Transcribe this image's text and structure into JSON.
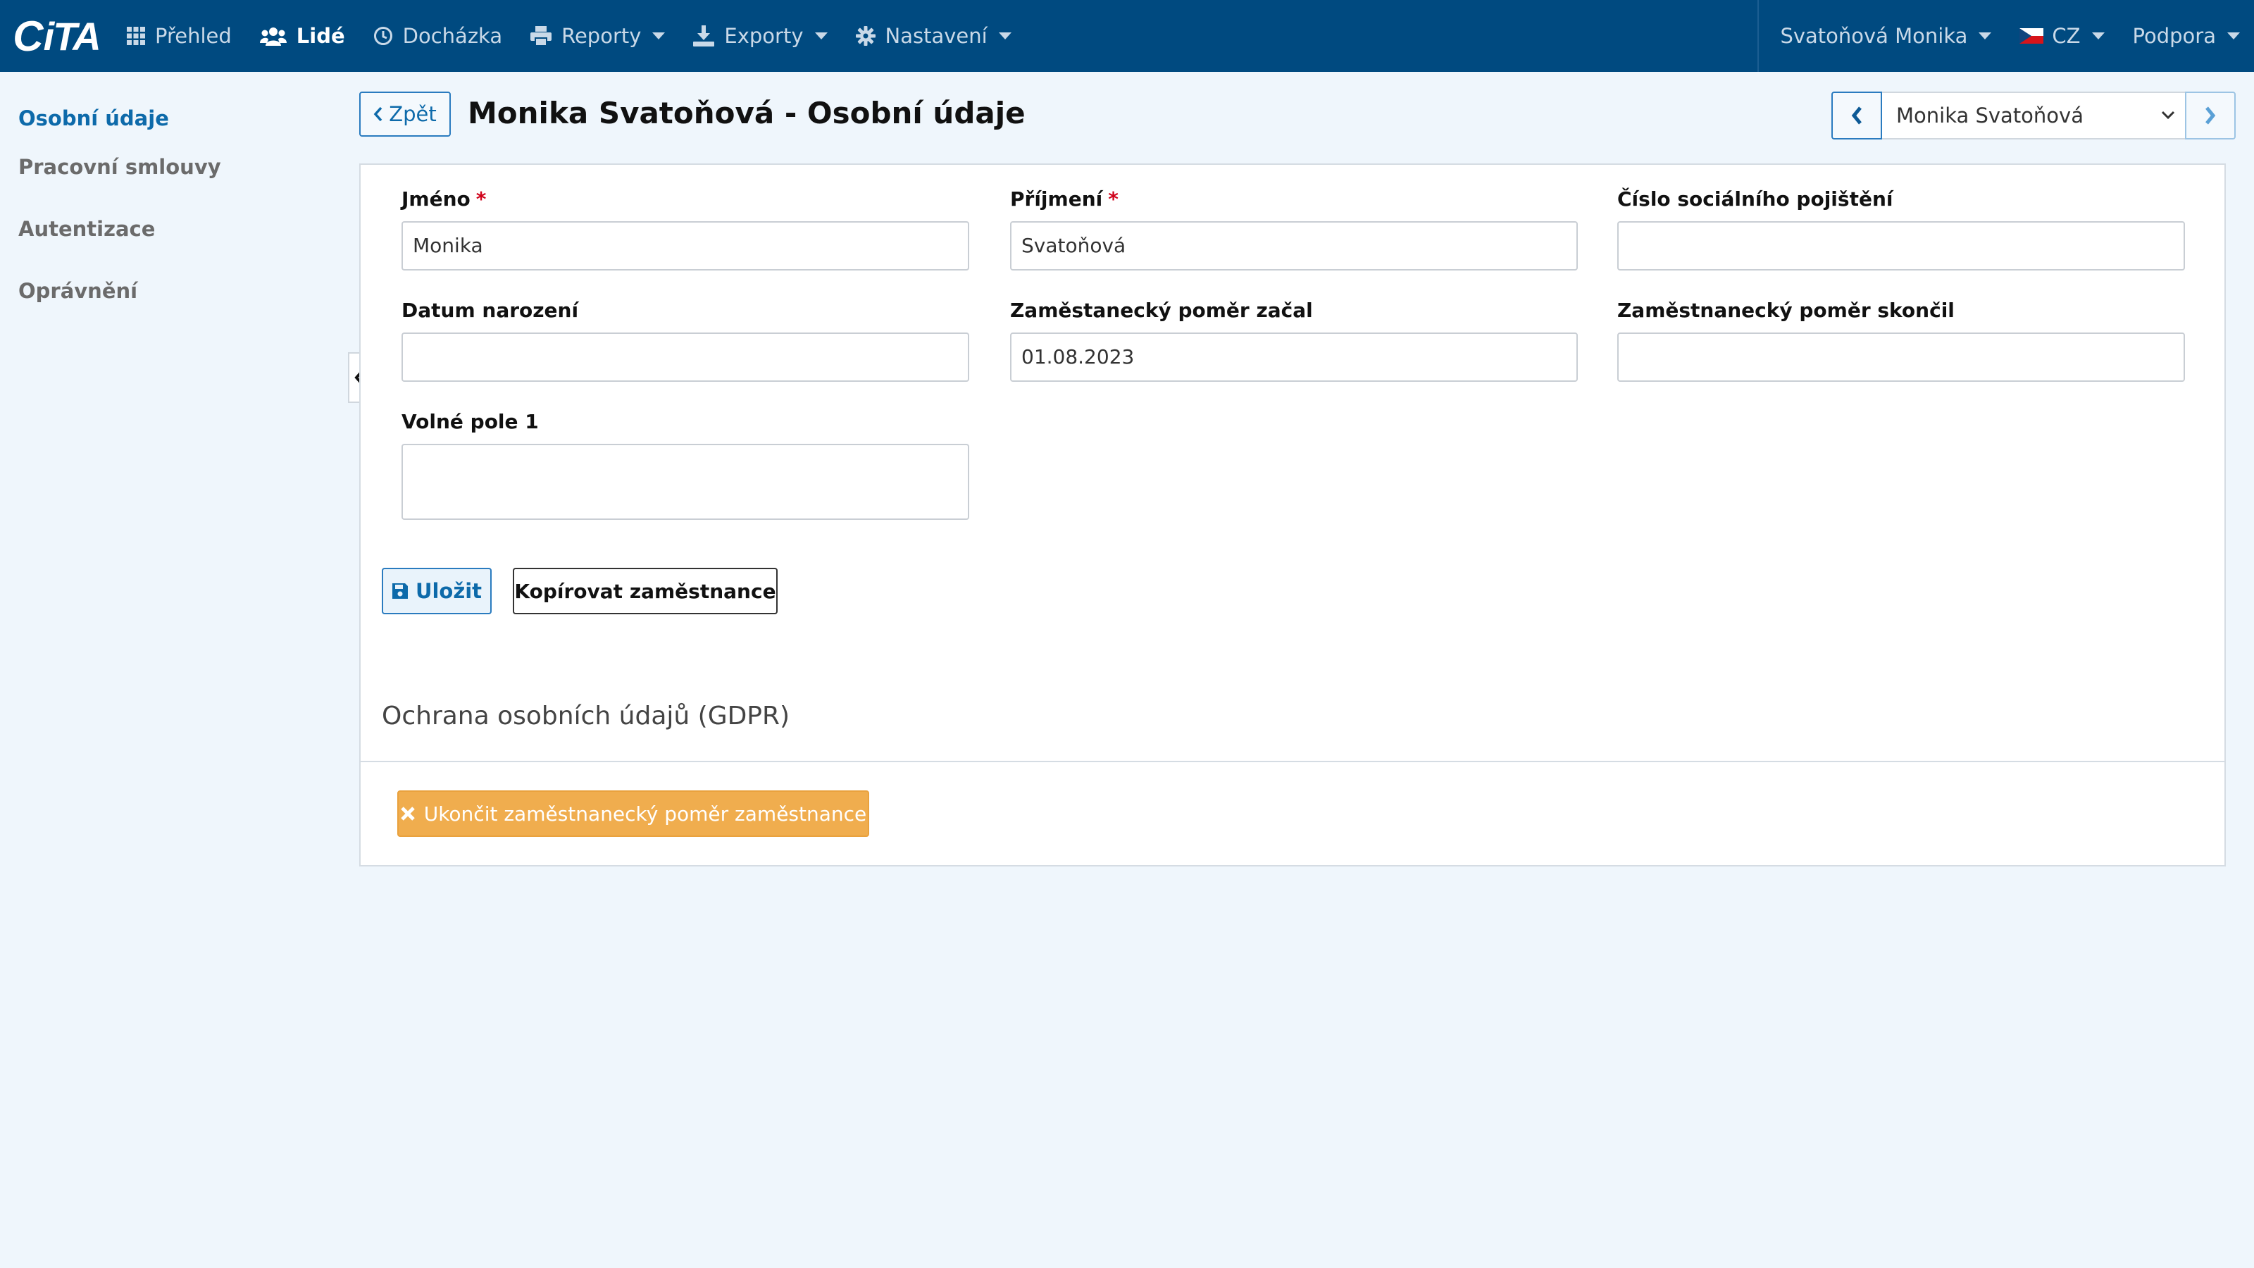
{
  "app": {
    "logo_text": "iTA"
  },
  "navbar": {
    "items": [
      {
        "label": "Přehled",
        "icon": "grid-icon",
        "active": false,
        "dropdown": false
      },
      {
        "label": "Lidé",
        "icon": "users-icon",
        "active": true,
        "dropdown": false
      },
      {
        "label": "Docházka",
        "icon": "clock-icon",
        "active": false,
        "dropdown": false
      },
      {
        "label": "Reporty",
        "icon": "printer-icon",
        "active": false,
        "dropdown": true
      },
      {
        "label": "Exporty",
        "icon": "download-icon",
        "active": false,
        "dropdown": true
      },
      {
        "label": "Nastavení",
        "icon": "gear-icon",
        "active": false,
        "dropdown": true
      }
    ],
    "user": "Svatoňová Monika",
    "language": "CZ",
    "support": "Podpora",
    "colors": {
      "background": "#004a80",
      "text": "#c9d9e8",
      "active_text": "#ffffff"
    }
  },
  "sidebar": {
    "items": [
      {
        "label": "Osobní údaje",
        "active": true
      },
      {
        "label": "Pracovní smlouvy",
        "active": false
      },
      {
        "label": "Autentizace",
        "active": false
      },
      {
        "label": "Oprávnění",
        "active": false
      }
    ]
  },
  "header": {
    "back_label": "Zpět",
    "title": "Monika Svatoňová - Osobní údaje",
    "employee_select": "Monika Svatoňová"
  },
  "form": {
    "first_name": {
      "label": "Jméno",
      "required_mark": "*",
      "value": "Monika"
    },
    "last_name": {
      "label": "Příjmení",
      "required_mark": "*",
      "value": "Svatoňová"
    },
    "social_insurance": {
      "label": "Číslo sociálního pojištění",
      "value": ""
    },
    "birth_date": {
      "label": "Datum narození",
      "value": ""
    },
    "employment_start": {
      "label": "Zaměstanecký poměr začal",
      "value": "01.08.2023"
    },
    "employment_end": {
      "label": "Zaměstnanecký poměr skončil",
      "value": ""
    },
    "free_field_1": {
      "label": "Volné pole 1",
      "value": ""
    },
    "save_label": "Uložit",
    "copy_label": "Kopírovat zaměstnance"
  },
  "gdpr": {
    "title": "Ochrana osobních údajů (GDPR)",
    "terminate_label": "Ukončit zaměstnanecký poměr zaměstnance",
    "terminate_color": "#f0ad4e"
  }
}
